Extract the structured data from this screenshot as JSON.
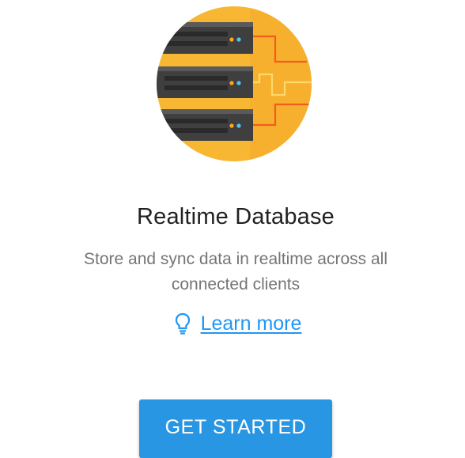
{
  "product": {
    "title": "Realtime Database",
    "description": "Store and sync data in realtime across all connected clients",
    "illustration_icon": "server-rack-icon"
  },
  "learn_more": {
    "label": "Learn more",
    "icon": "lightbulb-icon"
  },
  "cta": {
    "label": "GET STARTED"
  },
  "colors": {
    "accent": "#2196f3",
    "button": "#2896e3",
    "illustration_bg": "#f7b733",
    "server": "#4a4a4a",
    "wire": "#f25c1c"
  }
}
